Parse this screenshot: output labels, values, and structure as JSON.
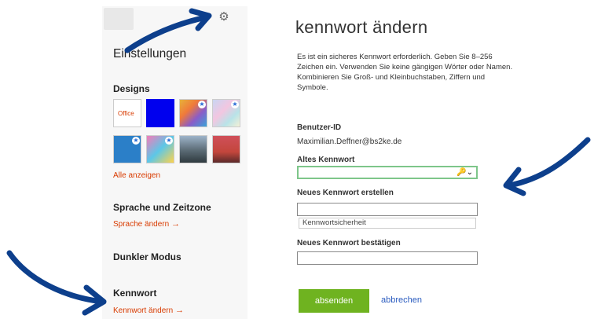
{
  "settings": {
    "title": "Einstellungen",
    "designs_heading": "Designs",
    "office_theme_label": "Office",
    "show_all_link": "Alle anzeigen",
    "language_heading": "Sprache und Zeitzone",
    "language_link": "Sprache ändern",
    "dark_mode_heading": "Dunkler Modus",
    "password_heading": "Kennwort",
    "password_link": "Kennwort ändern",
    "link_arrow": "→"
  },
  "form": {
    "title": "kennwort ändern",
    "description": "Es ist ein sicheres Kennwort erforderlich. Geben Sie 8–256 Zeichen ein. Verwenden Sie keine gängigen Wörter oder Namen. Kombinieren Sie Groß- und Kleinbuchstaben, Ziffern und Symbole.",
    "user_id_label": "Benutzer-ID",
    "user_id_value": "Maximilian.Deffner@bs2ke.de",
    "old_password_label": "Altes Kennwort",
    "new_password_label": "Neues Kennwort erstellen",
    "strength_label": "Kennwortsicherheit",
    "confirm_password_label": "Neues Kennwort bestätigen",
    "submit_label": "absenden",
    "cancel_label": "abbrechen"
  },
  "colors": {
    "accent_link": "#d83b01",
    "submit_green": "#6fb320",
    "annotation_blue": "#0d3f8c"
  },
  "icons": [
    "gear-icon",
    "key-icon",
    "star-badge-icon",
    "arrow-right-icon"
  ]
}
